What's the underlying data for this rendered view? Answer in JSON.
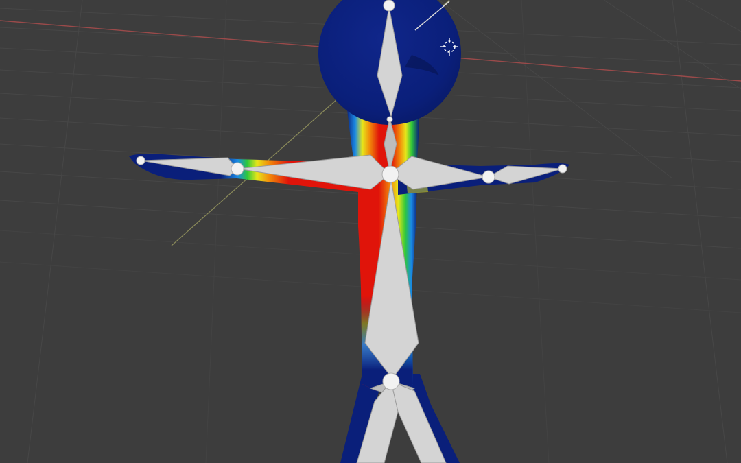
{
  "viewport": {
    "mode": "weight-paint",
    "background_color": "#3d3d3d",
    "grid_color": "#474747",
    "axis_x_color": "#9a4a4a",
    "axis_y_color": "#8a8a5a"
  },
  "mesh": {
    "zero_weight_color": "#0a1f7a",
    "full_weight_color": "#e0140a",
    "gradient_colors": [
      "#e0140a",
      "#f28c0a",
      "#e6e61a",
      "#2ec83a",
      "#1a8ae6",
      "#0a1f7a"
    ]
  },
  "armature": {
    "bone_color": "#d4d4d4",
    "joint_color": "#f2f2f2",
    "bones": [
      "head",
      "neck",
      "spine",
      "upper-arm-left",
      "forearm-left",
      "upper-arm-right",
      "forearm-right",
      "pelvis",
      "thigh-left",
      "thigh-right"
    ]
  },
  "cursor": {
    "icon": "3d-cursor-icon"
  }
}
